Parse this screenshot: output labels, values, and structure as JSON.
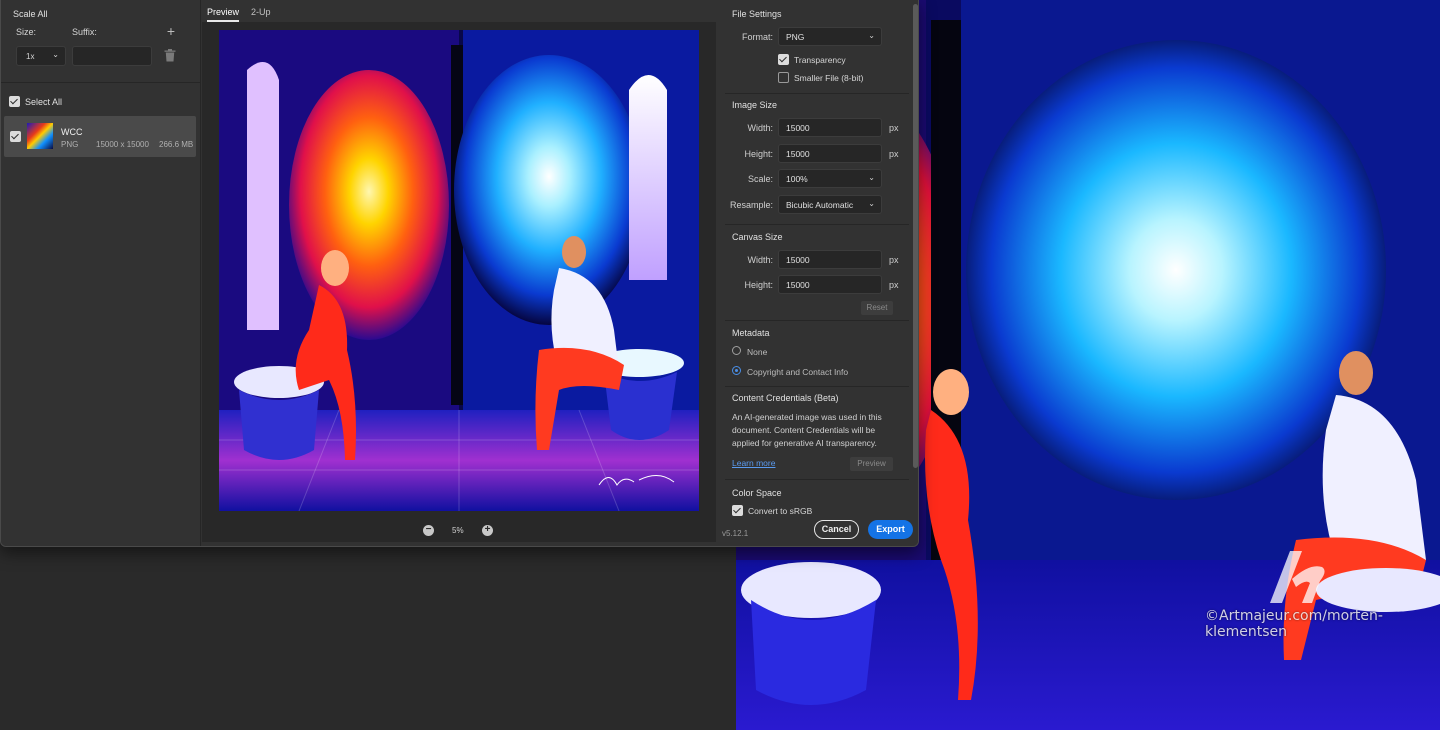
{
  "left_panel": {
    "title": "Scale All",
    "size_label": "Size:",
    "suffix_label": "Suffix:",
    "size_value": "1x",
    "suffix_value": "",
    "select_all_label": "Select All",
    "select_all_checked": true,
    "item": {
      "name": "WCC",
      "format": "PNG",
      "dimensions": "15000 x 15000",
      "file_size": "266.6 MB",
      "checked": true
    }
  },
  "preview": {
    "tabs": [
      {
        "label": "Preview",
        "active": true
      },
      {
        "label": "2-Up",
        "active": false
      }
    ],
    "zoom": "5%"
  },
  "settings": {
    "file_settings": {
      "title": "File Settings",
      "format_label": "Format:",
      "format_value": "PNG",
      "transparency_label": "Transparency",
      "transparency_checked": true,
      "smaller_file_label": "Smaller File (8-bit)",
      "smaller_file_checked": false
    },
    "image_size": {
      "title": "Image Size",
      "width_label": "Width:",
      "width_value": "15000",
      "height_label": "Height:",
      "height_value": "15000",
      "unit": "px",
      "scale_label": "Scale:",
      "scale_value": "100%",
      "resample_label": "Resample:",
      "resample_value": "Bicubic Automatic"
    },
    "canvas_size": {
      "title": "Canvas Size",
      "width_label": "Width:",
      "width_value": "15000",
      "height_label": "Height:",
      "height_value": "15000",
      "unit": "px",
      "reset_label": "Reset"
    },
    "metadata": {
      "title": "Metadata",
      "options": [
        {
          "label": "None",
          "selected": false
        },
        {
          "label": "Copyright and Contact Info",
          "selected": true
        }
      ]
    },
    "content_credentials": {
      "title": "Content Credentials (Beta)",
      "text": "An AI-generated image was used in this document. Content Credentials will be applied for generative AI transparency.",
      "learn_more": "Learn more",
      "preview_label": "Preview"
    },
    "color_space": {
      "title": "Color Space",
      "convert_label": "Convert to sRGB",
      "convert_checked": true
    },
    "version": "v5.12.1",
    "cancel_label": "Cancel",
    "export_label": "Export"
  },
  "artwork": {
    "signature": "Morten Klementsen",
    "watermark": "©Artmajeur.com/morten-klementsen"
  },
  "colors": {
    "accent": "#1473e6",
    "dialog_bg": "#323232",
    "preview_bg": "#282828",
    "link": "#5a9bf0"
  }
}
